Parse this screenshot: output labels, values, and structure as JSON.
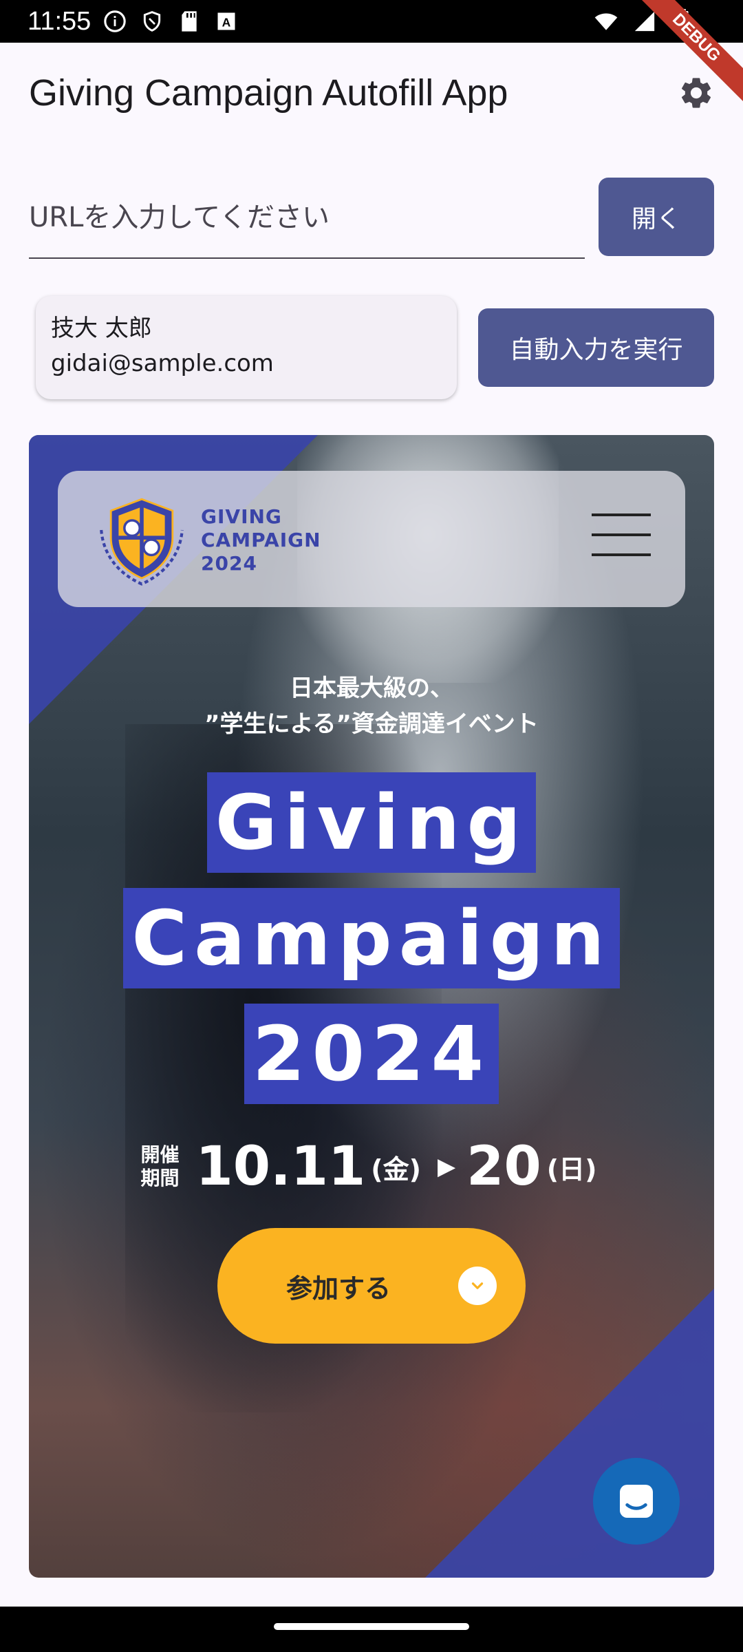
{
  "status_bar": {
    "time": "11:55",
    "left_icons": [
      "info-icon",
      "shield-icon",
      "sd-card-icon",
      "keyboard-icon"
    ],
    "right_icons": [
      "wifi-icon",
      "signal-icon",
      "battery-icon"
    ]
  },
  "debug_banner": "DEBUG",
  "app_bar": {
    "title": "Giving Campaign Autofill App",
    "settings_icon": "gear-icon"
  },
  "url_input": {
    "placeholder": "URLを入力してください",
    "value": ""
  },
  "open_button": {
    "label": "開く"
  },
  "profile": {
    "name": "技大 太郎",
    "email": "gidai@sample.com"
  },
  "autofill_button": {
    "label": "自動入力を実行"
  },
  "webview": {
    "logo_text": [
      "GIVING",
      "CAMPAIGN",
      "2024"
    ],
    "tagline_line1": "日本最大級の、",
    "tagline_line2": "”学生による”資金調達イベント",
    "title_lines": [
      "Giving",
      "Campaign",
      "2024"
    ],
    "date": {
      "label_line1": "開催",
      "label_line2": "期間",
      "start": "10.11",
      "start_day": "(金)",
      "end": "20",
      "end_day": "(日)"
    },
    "join_button": {
      "label": "参加する"
    },
    "chat_icon": "chat-icon",
    "colors": {
      "accent_blue": "#3a44b8",
      "join_yellow": "#fbb321",
      "chat_blue": "#1569b8"
    }
  },
  "colors": {
    "primary_button": "#4f5892",
    "background": "#fbf8fe"
  }
}
